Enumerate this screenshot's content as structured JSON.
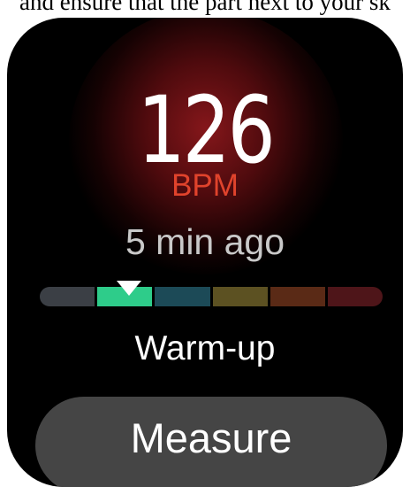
{
  "caption": "and ensure that the part next to your sk",
  "reading": {
    "value": "126",
    "unit": "BPM",
    "time_ago": "5 min ago"
  },
  "zones": {
    "segment_colors": [
      "#3b3f45",
      "#2ecc8a",
      "#1c4a57",
      "#5c5122",
      "#5a2a16",
      "#4e1519"
    ],
    "current_index": 1,
    "current_label": "Warm-up"
  },
  "actions": {
    "measure_label": "Measure"
  },
  "colors": {
    "unit": "#e0432c",
    "button_bg": "#454545",
    "glow": "#8c181c"
  }
}
